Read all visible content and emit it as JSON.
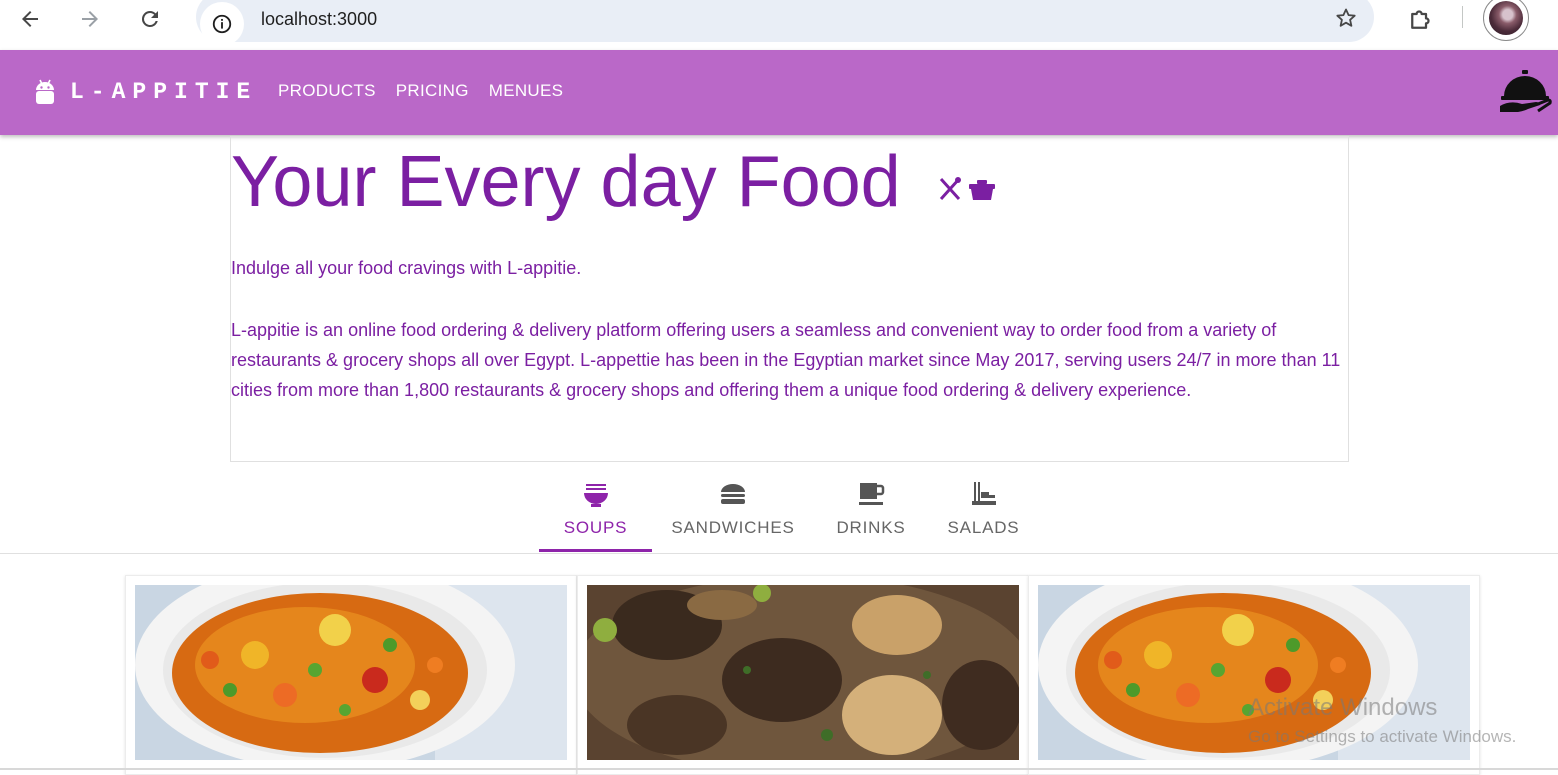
{
  "browser": {
    "url": "localhost:3000",
    "icons": [
      "back-arrow-icon",
      "forward-arrow-icon",
      "reload-icon",
      "info-icon",
      "star-icon",
      "extensions-icon",
      "profile-avatar"
    ]
  },
  "appbar": {
    "brand": "L-APPITIE",
    "brand_icon": "android-icon",
    "links": [
      "PRODUCTS",
      "PRICING",
      "MENUES"
    ],
    "right_icon": "room-service-cloche-icon",
    "background": "#ba68c8"
  },
  "hero": {
    "title": "Your Every day Food",
    "title_icons": [
      "fork-knife-icon",
      "bento-box-icon"
    ],
    "intro": "Indulge all your food cravings with L-appitie.",
    "description": "L-appitie is an online food ordering & delivery platform offering users a seamless and convenient way to order food from a variety of restaurants & grocery shops all over Egypt. L-appettie has been in the Egyptian market since May 2017, serving users 24/7 in more than 11 cities from more than 1,800 restaurants & grocery shops and offering them a unique food ordering & delivery experience.",
    "text_color": "#7b1fa2"
  },
  "tabs": [
    {
      "label": "SOUPS",
      "icon": "ramen-bowl-icon",
      "active": true
    },
    {
      "label": "SANDWICHES",
      "icon": "burger-icon",
      "active": false
    },
    {
      "label": "DRINKS",
      "icon": "coffee-cup-icon",
      "active": false
    },
    {
      "label": "SALADS",
      "icon": "bento-tray-icon",
      "active": false
    }
  ],
  "cards": [
    {
      "image": "vegetable-soup-photo"
    },
    {
      "image": "beef-stew-photo"
    },
    {
      "image": "vegetable-soup-photo"
    }
  ],
  "watermark": {
    "title": "Activate Windows",
    "subtitle": "Go to Settings to activate Windows."
  },
  "accent": "#8e24aa"
}
